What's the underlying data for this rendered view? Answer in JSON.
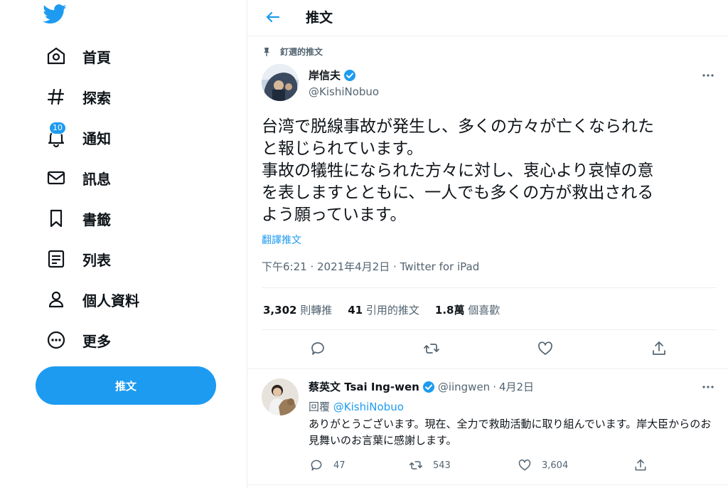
{
  "colors": {
    "accent": "#1d9bf0",
    "text": "#0f1419",
    "muted": "#536471",
    "border": "#ebeef0"
  },
  "nav": {
    "items": [
      {
        "icon": "home-icon",
        "label": "首頁"
      },
      {
        "icon": "hashtag-icon",
        "label": "探索"
      },
      {
        "icon": "bell-icon",
        "label": "通知",
        "badge": "10"
      },
      {
        "icon": "envelope-icon",
        "label": "訊息"
      },
      {
        "icon": "bookmark-icon",
        "label": "書籤"
      },
      {
        "icon": "list-icon",
        "label": "列表"
      },
      {
        "icon": "person-icon",
        "label": "個人資料"
      },
      {
        "icon": "more-circle-icon",
        "label": "更多"
      }
    ],
    "compose_label": "推文"
  },
  "header": {
    "title": "推文"
  },
  "tweet": {
    "pinned_label": "釘選的推文",
    "author_name": "岸信夫",
    "author_handle": "@KishiNobuo",
    "text": "台湾で脱線事故が発生し、多くの方々が亡くなられた\nと報じられています。\n事故の犠牲になられた方々に対し、衷心より哀悼の意\nを表しますとともに、一人でも多くの方が救出される\nよう願っています。",
    "translate_label": "翻譯推文",
    "timestamp": "下午6:21 · 2021年4月2日 · ",
    "source": "Twitter for iPad",
    "stats": {
      "retweets_count": "3,302",
      "retweets_label": "則轉推",
      "quotes_count": "41",
      "quotes_label": "引用的推文",
      "likes_count": "1.8萬",
      "likes_label": "個喜歡"
    }
  },
  "reply": {
    "name": "蔡英文 Tsai Ing-wen",
    "handle": "@iingwen",
    "dot": "·",
    "date": "4月2日",
    "reply_prefix": "回覆 ",
    "reply_to": "@KishiNobuo",
    "text": "ありがとうございます。現在、全力で救助活動に取り組んでいます。岸大臣からのお見舞いのお言葉に感謝します。",
    "replies": "47",
    "retweets": "543",
    "likes": "3,604"
  }
}
